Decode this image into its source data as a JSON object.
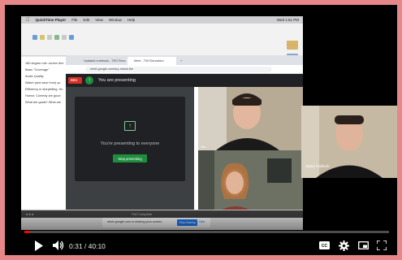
{
  "mac_menubar": {
    "app_name": "QuickTime Player",
    "menus": [
      "File",
      "Edit",
      "View",
      "Window",
      "Help"
    ],
    "right_status": "Wed 1:51 PM"
  },
  "browser": {
    "tabs": [
      "Updated notebook - TED Recc",
      "Meet - TWI Education",
      "+"
    ],
    "url": "meet.google.com/ary-mbwk-fbe"
  },
  "meet": {
    "rec_label": "REC",
    "presenting_text": "You are presenting",
    "share_message": "You're presenting to everyone",
    "stop_button": "Stop presenting",
    "self_label": "You",
    "guest_label": "Jacqueline Ehrlich"
  },
  "doc_lines": [
    "180 degree rule: screen dire",
    "Basic \"Coverage\"",
    "Audio Quality",
    "Watch (and save from) yo",
    "Efficiency in storytelling. Ho",
    "Humor. Comedy are good",
    "What are goals? What are"
  ],
  "dock_text": "TWI Complete",
  "notification": {
    "text": "meet.google.com is sharing your screen.",
    "stop_label": "Stop sharing",
    "hide_label": "Hide"
  },
  "webcam": {
    "name": "Taylor Kalbach"
  },
  "youtube": {
    "current_time": "0:31",
    "separator": " / ",
    "duration": "40:10",
    "progress_fraction": 0.013
  },
  "colors": {
    "frame": "#e6888a",
    "progress": "#ff0000",
    "meet_green": "#1e8e3e",
    "rec_red": "#d93025"
  },
  "icons": {
    "play": "play-icon",
    "volume": "volume-icon",
    "captions": "captions-icon",
    "settings": "gear-icon",
    "miniplayer": "miniplayer-icon",
    "fullscreen": "fullscreen-icon"
  }
}
